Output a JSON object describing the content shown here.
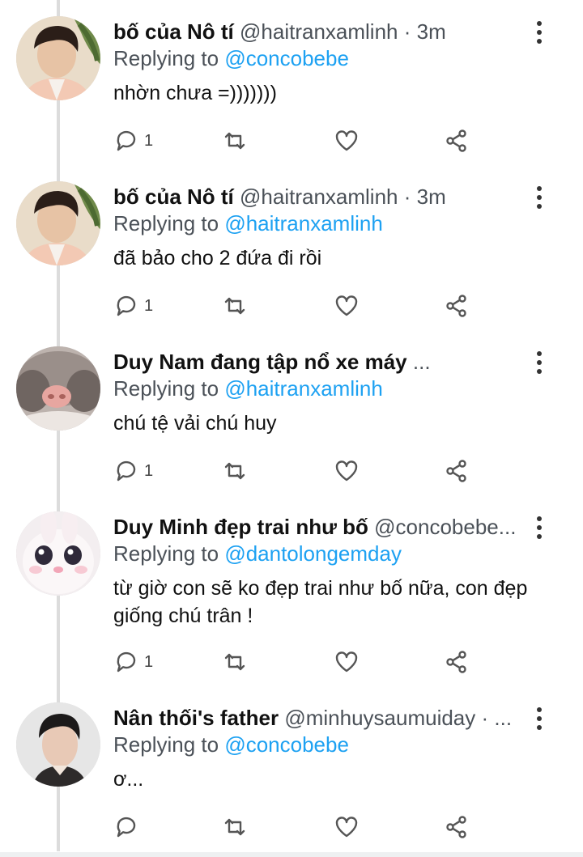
{
  "tweets": [
    {
      "name": "bố của Nô tí",
      "handle": "@haitranxamlinh · 3m",
      "replying_prefix": "Replying to ",
      "replying_to": "@concobebe",
      "body": "nhờn chưa =)))))))",
      "reply_count": "1",
      "avatar": "young-man-with-plant-avatar"
    },
    {
      "name": "bố của Nô tí",
      "handle": "@haitranxamlinh · 3m",
      "replying_prefix": "Replying to ",
      "replying_to": "@haitranxamlinh",
      "body": "đã bảo cho 2 đứa đi rồi",
      "reply_count": "1",
      "avatar": "young-man-with-plant-avatar"
    },
    {
      "name": "Duy Nam đang tập nổ xe máy",
      "handle": " ...",
      "replying_prefix": "Replying to ",
      "replying_to": "@haitranxamlinh",
      "body": "chú tệ vải chú huy",
      "reply_count": "1",
      "avatar": "hamster-nose-avatar"
    },
    {
      "name": "Duy Minh đẹp trai như bố",
      "handle": "@concobebe...",
      "replying_prefix": "Replying to ",
      "replying_to": "@dantolongemday",
      "body": "từ giờ con sẽ ko đẹp trai như bố nữa, con đẹp giống chú trân !",
      "reply_count": "1",
      "avatar": "white-bunny-avatar"
    },
    {
      "name": "Nân thối's father",
      "handle": "@minhuysaumuiday · ...",
      "replying_prefix": "Replying to ",
      "replying_to": "@concobebe",
      "body": "ơ...",
      "reply_count": "",
      "avatar": "man-portrait-avatar"
    }
  ],
  "colors": {
    "link": "#1da1f2",
    "secondary_text": "#4b5158",
    "thread_line": "#dcdcdc"
  },
  "icons": [
    "reply-icon",
    "retweet-icon",
    "like-icon",
    "share-icon",
    "more-options-icon"
  ]
}
